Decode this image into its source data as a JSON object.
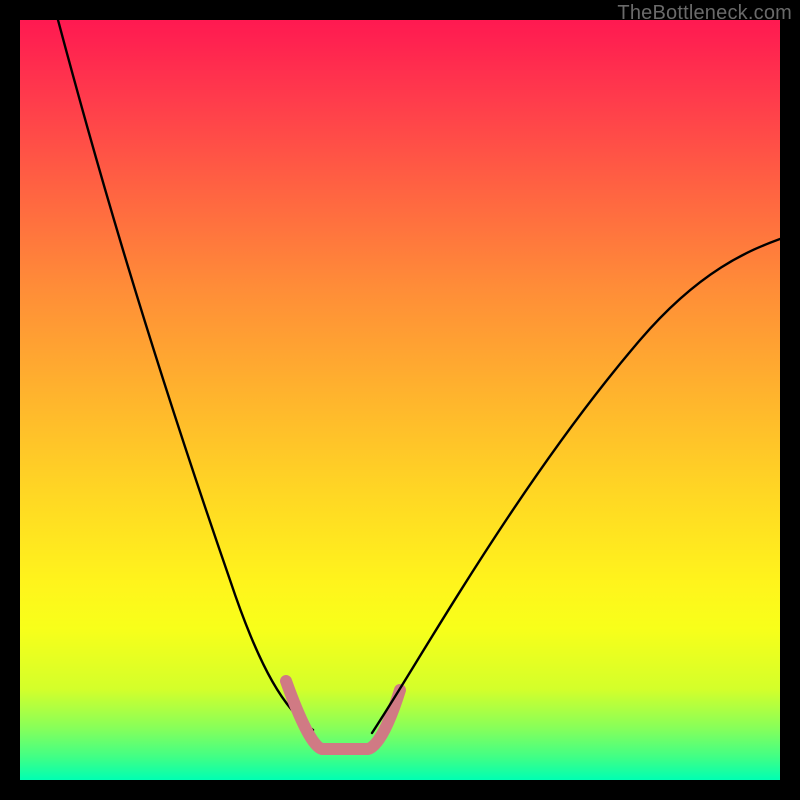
{
  "watermark": "TheBottleneck.com",
  "chart_data": {
    "type": "line",
    "title": "",
    "xlabel": "",
    "ylabel": "",
    "xlim": [
      0,
      100
    ],
    "ylim": [
      0,
      100
    ],
    "grid": false,
    "background_gradient": [
      "#ff1951",
      "#ffd624",
      "#00ffb3"
    ],
    "series": [
      {
        "name": "left-curve",
        "stroke": "#000000",
        "x": [
          5,
          8,
          11,
          14,
          17,
          20,
          23,
          26,
          29,
          32,
          35,
          38.5
        ],
        "y": [
          100,
          89,
          79,
          69,
          60,
          51,
          43,
          35,
          27,
          20,
          13,
          6.6
        ]
      },
      {
        "name": "valley-floor",
        "stroke": "#d07a84",
        "x": [
          35,
          36,
          37,
          38,
          38.5,
          39,
          40,
          41,
          43,
          45,
          46,
          47,
          48,
          49,
          50
        ],
        "y": [
          13,
          11.5,
          10,
          8.5,
          6.6,
          5.5,
          4.5,
          4,
          4,
          4,
          4.5,
          5.5,
          7,
          9,
          11.8
        ]
      },
      {
        "name": "right-curve",
        "stroke": "#000000",
        "x": [
          50,
          53,
          57,
          61,
          65,
          70,
          75,
          80,
          85,
          90,
          95,
          100
        ],
        "y": [
          11.8,
          16,
          22,
          28,
          34,
          41,
          47,
          53,
          58,
          63,
          67.5,
          71.2
        ]
      }
    ],
    "annotations": []
  }
}
